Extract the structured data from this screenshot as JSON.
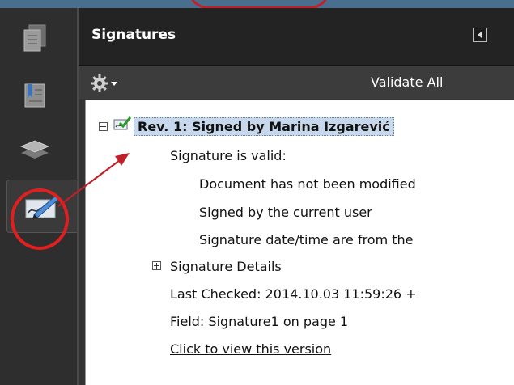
{
  "sidebar": {
    "tools": [
      {
        "name": "pages-tool",
        "active": false
      },
      {
        "name": "bookmarks-tool",
        "active": false
      },
      {
        "name": "layers-tool",
        "active": false
      },
      {
        "name": "signatures-tool",
        "active": true
      }
    ]
  },
  "panel": {
    "title": "Signatures",
    "toolbar": {
      "options_icon": "gear-icon",
      "validate_all_label": "Validate All"
    },
    "signature": {
      "title": "Rev. 1: Signed by Marina Izgarević",
      "status": "Signature is valid:",
      "details": [
        "Document has not been modified",
        "Signed by the current user",
        "Signature date/time are from the"
      ],
      "details_label": "Signature Details",
      "last_checked": "Last Checked: 2014.10.03 11:59:26 +",
      "field": "Field: Signature1 on page 1",
      "view_link": "Click to view this version"
    }
  },
  "colors": {
    "annotation_red": "#e02020",
    "selected_row": "#c8d8ec",
    "panel_header": "#232323"
  }
}
